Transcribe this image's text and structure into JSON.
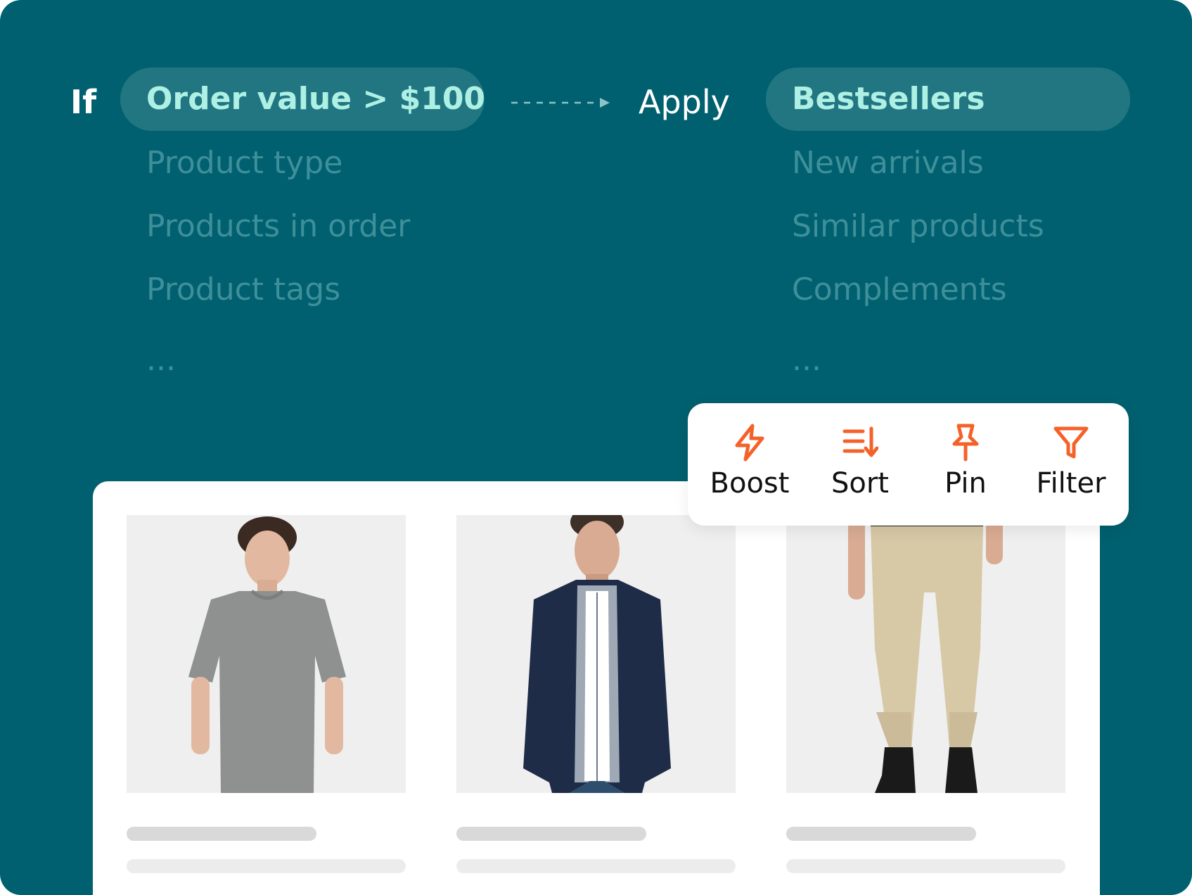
{
  "rule": {
    "if_label": "If",
    "condition_selected": "Order value > $100",
    "condition_options": [
      "Product type",
      "Products in order",
      "Product tags",
      "..."
    ],
    "apply_label": "Apply",
    "action_selected": "Bestsellers",
    "action_options": [
      "New arrivals",
      "Similar products",
      "Complements",
      "..."
    ]
  },
  "toolbar": {
    "items": [
      {
        "label": "Boost",
        "icon": "lightning-icon"
      },
      {
        "label": "Sort",
        "icon": "sort-icon"
      },
      {
        "label": "Pin",
        "icon": "pin-icon"
      },
      {
        "label": "Filter",
        "icon": "filter-icon"
      }
    ]
  },
  "products": [
    {
      "image": "grey-tshirt-model"
    },
    {
      "image": "navy-bomber-jacket-model"
    },
    {
      "image": "beige-chino-pants-model"
    }
  ],
  "colors": {
    "background": "#00606f",
    "pill": "#227682",
    "pill_text": "#aef0e4",
    "muted_option": "#3e8f99",
    "accent_icon": "#f4622a"
  }
}
